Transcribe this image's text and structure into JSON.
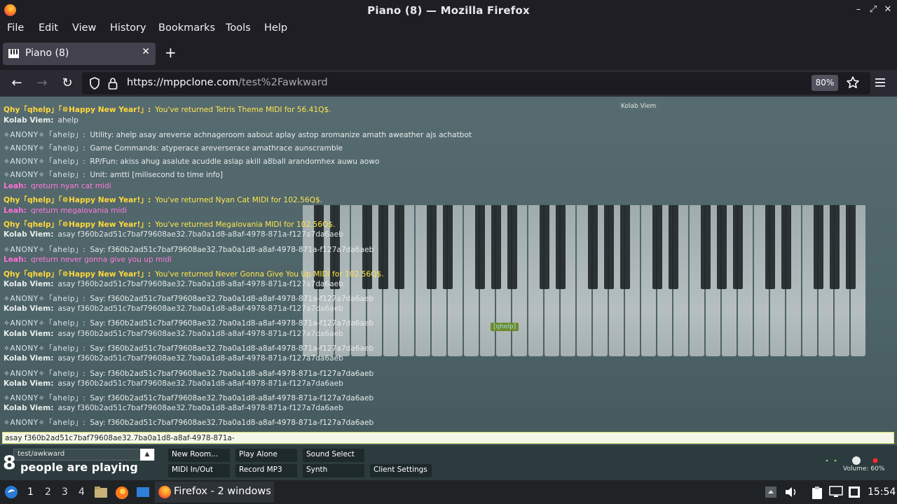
{
  "window": {
    "title": "Piano (8) — Mozilla Firefox"
  },
  "menu": [
    "File",
    "Edit",
    "View",
    "History",
    "Bookmarks",
    "Tools",
    "Help"
  ],
  "tab": {
    "title": "Piano (8)"
  },
  "url": {
    "host": "https://mppclone.com",
    "path": "/test%2Fawkward",
    "zoom": "80%"
  },
  "chat": {
    "messages": [
      {
        "nick": "Qhy「qhelp」「☸Happy New Year!」:",
        "text": "You've returned Tetris Theme MIDI for 56.41Q$.",
        "style": "qhy"
      },
      {
        "nick": "Kolab Viem:",
        "text": "ahelp",
        "style": "kolab"
      },
      {
        "nick": "✧ANONY✧「ahelp」:",
        "text": "Utility: ahelp asay areverse achnageroom aabout aplay astop aromanize amath aweather ajs achatbot",
        "style": "anon"
      },
      {
        "nick": "✧ANONY✧「ahelp」:",
        "text": "Game Commands: atyperace areverserace amathrace aunscramble",
        "style": "anon"
      },
      {
        "nick": "✧ANONY✧「ahelp」:",
        "text": "RP/Fun: akiss ahug asalute acuddle aslap akill a8ball arandomhex auwu aowo",
        "style": "anon"
      },
      {
        "nick": "✧ANONY✧「ahelp」:",
        "text": "Unit: amtti [milisecond to time info]",
        "style": "anon"
      },
      {
        "nick": "Leah:",
        "text": "qreturn nyan cat midi",
        "style": "leah"
      },
      {
        "nick": "Qhy「qhelp」「☸Happy New Year!」:",
        "text": "You've returned Nyan Cat MIDI for 102.56Q$.",
        "style": "qhy"
      },
      {
        "nick": "Leah:",
        "text": "qreturn megalovania midi",
        "style": "leah"
      },
      {
        "nick": "Qhy「qhelp」「☸Happy New Year!」:",
        "text": "You've returned Megalovania MIDI for 102.56Q$.",
        "style": "qhy"
      },
      {
        "nick": "Kolab Viem:",
        "text": "asay f360b2ad51c7baf79608ae32.7ba0a1d8-a8af-4978-871a-f127a7da6aeb",
        "style": "kolab"
      },
      {
        "nick": "✧ANONY✧「ahelp」:",
        "text": "Say: f360b2ad51c7baf79608ae32.7ba0a1d8-a8af-4978-871a-f127a7da6aeb",
        "style": "anon"
      },
      {
        "nick": "Leah:",
        "text": "qreturn never gonna give you up midi",
        "style": "leah"
      },
      {
        "nick": "Qhy「qhelp」「☸Happy New Year!」:",
        "text": "You've returned Never Gonna Give You Up MIDI for 102.56Q$.",
        "style": "qhy"
      },
      {
        "nick": "Kolab Viem:",
        "text": "asay f360b2ad51c7baf79608ae32.7ba0a1d8-a8af-4978-871a-f127a7da6aeb",
        "style": "kolab"
      },
      {
        "nick": "✧ANONY✧「ahelp」:",
        "text": "Say: f360b2ad51c7baf79608ae32.7ba0a1d8-a8af-4978-871a-f127a7da6aeb",
        "style": "anon"
      },
      {
        "nick": "Kolab Viem:",
        "text": "asay f360b2ad51c7baf79608ae32.7ba0a1d8-a8af-4978-871a-f127a7da6aeb",
        "style": "kolab"
      },
      {
        "nick": "✧ANONY✧「ahelp」:",
        "text": "Say: f360b2ad51c7baf79608ae32.7ba0a1d8-a8af-4978-871a-f127a7da6aeb",
        "style": "anon"
      },
      {
        "nick": "Kolab Viem:",
        "text": "asay f360b2ad51c7baf79608ae32.7ba0a1d8-a8af-4978-871a-f127a7da6aeb",
        "style": "kolab"
      },
      {
        "nick": "✧ANONY✧「ahelp」:",
        "text": "Say: f360b2ad51c7baf79608ae32.7ba0a1d8-a8af-4978-871a-f127a7da6aeb",
        "style": "anon"
      },
      {
        "nick": "Kolab Viem:",
        "text": "asay f360b2ad51c7baf79608ae32.7ba0a1d8-a8af-4978-871a-f127a7da6aeb",
        "style": "kolab"
      },
      {
        "nick": "✧ANONY✧「ahelp」:",
        "text": "Say: f360b2ad51c7baf79608ae32.7ba0a1d8-a8af-4978-871a-f127a7da6aeb",
        "style": "anon"
      },
      {
        "nick": "Kolab Viem:",
        "text": "asay f360b2ad51c7baf79608ae32.7ba0a1d8-a8af-4978-871a-f127a7da6aeb",
        "style": "kolab"
      },
      {
        "nick": "✧ANONY✧「ahelp」:",
        "text": "Say: f360b2ad51c7baf79608ae32.7ba0a1d8-a8af-4978-871a-f127a7da6aeb",
        "style": "anon"
      },
      {
        "nick": "Kolab Viem:",
        "text": "asay f360b2ad51c7baf79608ae32.7ba0a1d8-a8af-4978-871a-f127a7da6aeb",
        "style": "kolab"
      },
      {
        "nick": "✧ANONY✧「ahelp」:",
        "text": "Say: f360b2ad51c7baf79608ae32.7ba0a1d8-a8af-4978-871a-f127a7da6aeb",
        "style": "anon"
      }
    ],
    "input_value": "asay f360b2ad51c7baf79608ae32.7ba0a1d8-a8af-4978-871a-"
  },
  "user_tags": [
    {
      "text": "Kolab Viem",
      "color": "#dfe6e6"
    },
    {
      "text": "[qhelp]",
      "color": "#9fe0ea"
    }
  ],
  "bottom": {
    "count": "8",
    "count_label": "people are playing",
    "room": "test/awkward",
    "buttons": [
      "New Room...",
      "Play Alone",
      "Sound Select",
      "MIDI In/Out",
      "Record MP3",
      "Synth",
      "Client Settings"
    ],
    "volume": "Volume: 60%"
  },
  "taskbar": {
    "workspaces": [
      "1",
      "2",
      "3",
      "4"
    ],
    "task_label": "Firefox - 2 windows",
    "clock": "15:54"
  },
  "colors": {
    "qhy": "#ffd83a",
    "leah": "#ff6fd8",
    "chat_bg": "#4f6367",
    "firefox_chrome": "#1f1e25"
  }
}
